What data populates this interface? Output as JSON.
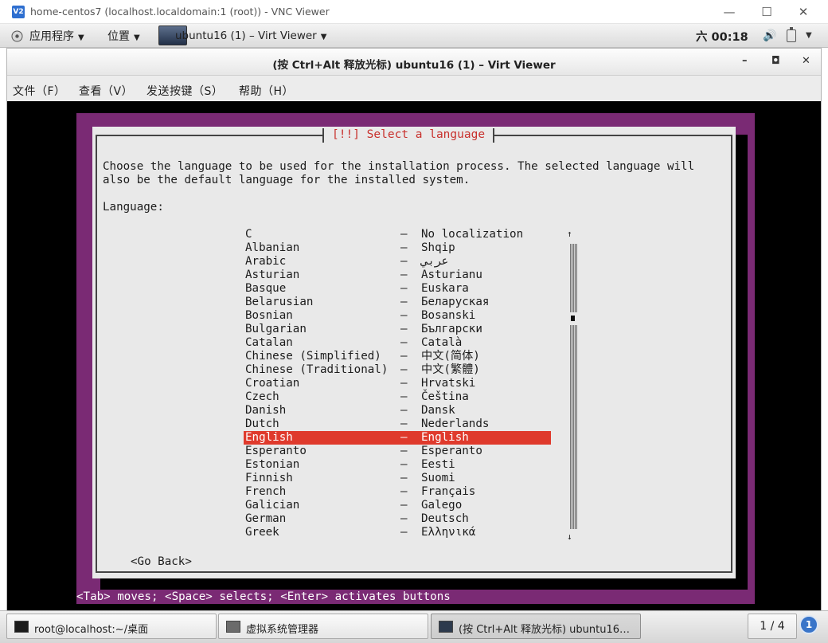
{
  "vnc_window": {
    "icon_text": "V2",
    "title": "home-centos7 (localhost.localdomain:1 (root)) - VNC Viewer",
    "minimize": "—",
    "maximize": "☐",
    "close": "✕"
  },
  "gnome_panel": {
    "applications": "应用程序",
    "places": "位置",
    "window_title": "ubuntu16 (1) – Virt Viewer",
    "clock": "六 00:18",
    "volume_icon": "🔊"
  },
  "virt_viewer": {
    "title": "(按 Ctrl+Alt 释放光标) ubuntu16 (1) – Virt Viewer",
    "minimize": "–",
    "maximize": "◘",
    "close": "✕",
    "menu": [
      "文件（F）",
      "查看（V）",
      "发送按键（S）",
      "帮助（H）"
    ]
  },
  "installer": {
    "dialog_title": "[!!] Select a language",
    "description_line1": "Choose the language to be used for the installation process. The selected language will",
    "description_line2": "also be the default language for the installed system.",
    "language_label": "Language:",
    "languages": [
      {
        "name": "C",
        "native": "No localization"
      },
      {
        "name": "Albanian",
        "native": "Shqip"
      },
      {
        "name": "Arabic",
        "native": "عربي"
      },
      {
        "name": "Asturian",
        "native": "Asturianu"
      },
      {
        "name": "Basque",
        "native": "Euskara"
      },
      {
        "name": "Belarusian",
        "native": "Беларуская"
      },
      {
        "name": "Bosnian",
        "native": "Bosanski"
      },
      {
        "name": "Bulgarian",
        "native": "Български"
      },
      {
        "name": "Catalan",
        "native": "Català"
      },
      {
        "name": "Chinese (Simplified)",
        "native": "中文(简体)"
      },
      {
        "name": "Chinese (Traditional)",
        "native": "中文(繁體)"
      },
      {
        "name": "Croatian",
        "native": "Hrvatski"
      },
      {
        "name": "Czech",
        "native": "Čeština"
      },
      {
        "name": "Danish",
        "native": "Dansk"
      },
      {
        "name": "Dutch",
        "native": "Nederlands"
      },
      {
        "name": "English",
        "native": "English",
        "selected": true
      },
      {
        "name": "Esperanto",
        "native": "Esperanto"
      },
      {
        "name": "Estonian",
        "native": "Eesti"
      },
      {
        "name": "Finnish",
        "native": "Suomi"
      },
      {
        "name": "French",
        "native": "Français"
      },
      {
        "name": "Galician",
        "native": "Galego"
      },
      {
        "name": "German",
        "native": "Deutsch"
      },
      {
        "name": "Greek",
        "native": "Ελληνικά"
      }
    ],
    "separator": "–",
    "scroll_up": "↑",
    "scroll_down": "↓",
    "go_back": "<Go Back>",
    "help_line": "<Tab> moves; <Space> selects; <Enter> activates buttons"
  },
  "taskbar": {
    "tasks": [
      {
        "label": "root@localhost:~/桌面",
        "icon": "terminal-icon"
      },
      {
        "label": "虚拟系统管理器",
        "icon": "virt-manager-icon"
      },
      {
        "label": "(按 Ctrl+Alt 释放光标) ubuntu16…",
        "icon": "virt-viewer-icon",
        "active": true
      }
    ],
    "workspace": "1 / 4",
    "notification_count": "1"
  },
  "colors": {
    "installer_background": "#7a2a74",
    "dialog_background": "#e9e9e9",
    "selection": "#df3a2c",
    "title_red": "#c8312d"
  }
}
